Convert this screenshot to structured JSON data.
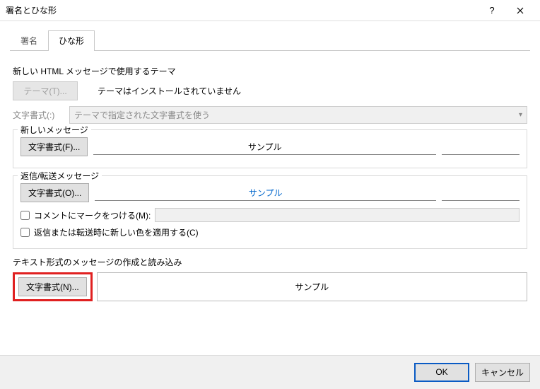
{
  "window": {
    "title": "署名とひな形"
  },
  "tabs": {
    "signature": "署名",
    "stationery": "ひな形"
  },
  "theme": {
    "heading": "新しい HTML メッセージで使用するテーマ",
    "btn": "テーマ(T)...",
    "note": "テーマはインストールされていません",
    "fontlabel": "文字書式(:)",
    "fontselect": "テーマで指定された文字書式を使う"
  },
  "newmsg": {
    "legend": "新しいメッセージ",
    "btn": "文字書式(F)...",
    "sample": "サンプル"
  },
  "reply": {
    "legend": "返信/転送メッセージ",
    "btn": "文字書式(O)...",
    "sample": "サンプル"
  },
  "opts": {
    "mark": "コメントにマークをつける(M):",
    "color": "返信または転送時に新しい色を適用する(C)"
  },
  "plain": {
    "heading": "テキスト形式のメッセージの作成と読み込み",
    "btn": "文字書式(N)...",
    "sample": "サンプル"
  },
  "footer": {
    "ok": "OK",
    "cancel": "キャンセル"
  }
}
